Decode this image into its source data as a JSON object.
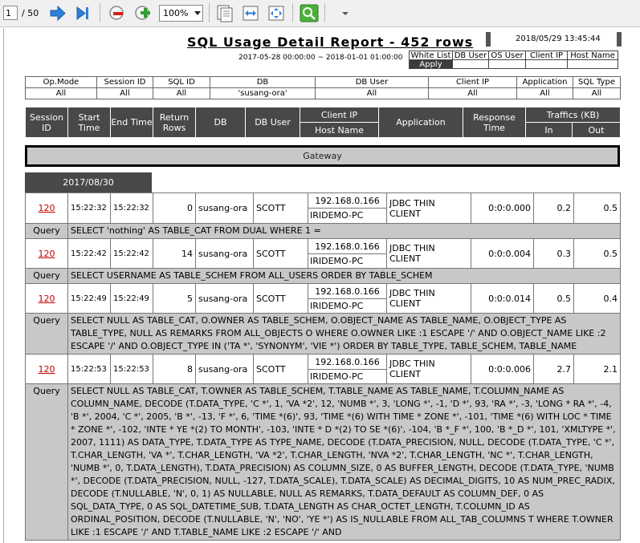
{
  "toolbar": {
    "page_current": "1",
    "page_total": "/ 50",
    "zoom": "100%"
  },
  "report": {
    "title": "SQL Usage Detail Report - 452 rows",
    "timestamp": "2018/05/29 13:45:44",
    "period": "2017-05-28 00:00:00 ~ 2018-01-01 01:00:00",
    "whitelist": {
      "headers": [
        "White List",
        "DB User",
        "OS User",
        "Client IP",
        "Host Name"
      ],
      "apply": "Apply"
    },
    "filter": {
      "headers": [
        "Op.Mode",
        "Session ID",
        "SQL ID",
        "DB",
        "DB User",
        "Client IP",
        "Application",
        "SQL Type"
      ],
      "values": [
        "All",
        "All",
        "All",
        "'susang-ora'",
        "All",
        "All",
        "All",
        "All"
      ]
    },
    "columns": {
      "session_id": "Session ID",
      "start_time": "Start Time",
      "end_time": "End Time",
      "return_rows": "Return Rows",
      "db": "DB",
      "db_user": "DB User",
      "client_ip": "Client IP",
      "host_name": "Host Name",
      "application": "Application",
      "response_time": "Response Time",
      "traffics": "Traffics (KB)",
      "in": "In",
      "out": "Out"
    },
    "gateway": "Gateway",
    "date_group": "2017/08/30",
    "query_label": "Query",
    "rows": [
      {
        "session": "120",
        "start": "15:22:32",
        "end": "15:22:32",
        "rows": "0",
        "db": "susang-ora",
        "user": "SCOTT",
        "ip": "192.168.0.166",
        "host": "IRIDEMO-PC",
        "app": "JDBC THIN CLIENT",
        "resp": "0:0:0.000",
        "in": "0.2",
        "out": "0.5",
        "query": "SELECT 'nothing' AS TABLE_CAT FROM DUAL WHERE 1 ="
      },
      {
        "session": "120",
        "start": "15:22:42",
        "end": "15:22:42",
        "rows": "14",
        "db": "susang-ora",
        "user": "SCOTT",
        "ip": "192.168.0.166",
        "host": "IRIDEMO-PC",
        "app": "JDBC THIN CLIENT",
        "resp": "0:0:0.004",
        "in": "0.3",
        "out": "0.5",
        "query": "SELECT USERNAME AS TABLE_SCHEM FROM ALL_USERS ORDER BY TABLE_SCHEM"
      },
      {
        "session": "120",
        "start": "15:22:49",
        "end": "15:22:49",
        "rows": "5",
        "db": "susang-ora",
        "user": "SCOTT",
        "ip": "192.168.0.166",
        "host": "IRIDEMO-PC",
        "app": "JDBC THIN CLIENT",
        "resp": "0:0:0.014",
        "in": "0.5",
        "out": "0.4",
        "query": "SELECT NULL AS TABLE_CAT, O.OWNER AS TABLE_SCHEM, O.OBJECT_NAME AS TABLE_NAME, O.OBJECT_TYPE AS TABLE_TYPE, NULL AS REMARKS FROM ALL_OBJECTS O WHERE O.OWNER LIKE :1 ESCAPE '/' AND O.OBJECT_NAME LIKE :2 ESCAPE '/' AND O.OBJECT_TYPE IN ('TA *', 'SYNONYM', 'VIE *') ORDER BY TABLE_TYPE, TABLE_SCHEM, TABLE_NAME"
      },
      {
        "session": "120",
        "start": "15:22:53",
        "end": "15:22:53",
        "rows": "8",
        "db": "susang-ora",
        "user": "SCOTT",
        "ip": "192.168.0.166",
        "host": "IRIDEMO-PC",
        "app": "JDBC THIN CLIENT",
        "resp": "0:0:0.006",
        "in": "2.7",
        "out": "2.1",
        "query": "SELECT NULL AS TABLE_CAT, T.OWNER AS TABLE_SCHEM, T.TABLE_NAME AS TABLE_NAME, T.COLUMN_NAME AS COLUMN_NAME, DECODE (T.DATA_TYPE, 'C *', 1, 'VA *2', 12, 'NUMB *', 3, 'LONG *', -1, 'D *', 93, 'RA *', -3, 'LONG * RA *', -4, 'B *', 2004, 'C *', 2005, 'B *', -13, 'F *', 6, 'TIME *(6)', 93, 'TIME *(6) WITH TIME * ZONE *', -101, 'TIME *(6) WITH LOC * TIME * ZONE *', -102, 'INTE * YE *(2) TO MONTH', -103, 'INTE * D *(2) TO SE *(6)', -104, 'B *_F *', 100, 'B *_D *', 101, 'XMLTYPE *', 2007, 1111) AS DATA_TYPE, T.DATA_TYPE AS TYPE_NAME, DECODE (T.DATA_PRECISION, NULL, DECODE (T.DATA_TYPE, 'C *', T.CHAR_LENGTH, 'VA *', T.CHAR_LENGTH, 'VA *2', T.CHAR_LENGTH, 'NVA *2', T.CHAR_LENGTH, 'NC *', T.CHAR_LENGTH, 'NUMB *', 0, T.DATA_LENGTH), T.DATA_PRECISION) AS COLUMN_SIZE, 0 AS BUFFER_LENGTH, DECODE (T.DATA_TYPE, 'NUMB *', DECODE (T.DATA_PRECISION, NULL, -127, T.DATA_SCALE), T.DATA_SCALE) AS DECIMAL_DIGITS, 10 AS NUM_PREC_RADIX, DECODE (T.NULLABLE, 'N', 0, 1) AS NULLABLE, NULL AS REMARKS, T.DATA_DEFAULT AS COLUMN_DEF, 0 AS SQL_DATA_TYPE, 0 AS SQL_DATETIME_SUB, T.DATA_LENGTH AS CHAR_OCTET_LENGTH, T.COLUMN_ID AS ORDINAL_POSITION, DECODE (T.NULLABLE, 'N', 'NO', 'YE *') AS IS_NULLABLE FROM ALL_TAB_COLUMNS T WHERE T.OWNER LIKE :1 ESCAPE '/' AND T.TABLE_NAME LIKE :2 ESCAPE '/' AND"
      }
    ]
  }
}
